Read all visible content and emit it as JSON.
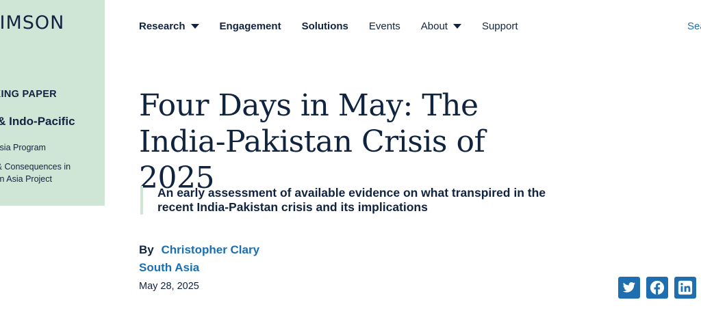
{
  "brand": {
    "logo_text": "TIMSON"
  },
  "sidebar": {
    "type_label": "RKING PAPER",
    "region_label": "a & Indo-Pacific",
    "links": [
      "th Asia Program",
      "es & Consequences in thern Asia Project"
    ]
  },
  "nav": {
    "items": [
      {
        "label": "Research",
        "has_dropdown": true
      },
      {
        "label": "Engagement",
        "has_dropdown": false
      },
      {
        "label": "Solutions",
        "has_dropdown": false
      },
      {
        "label": "Events",
        "has_dropdown": false
      },
      {
        "label": "About",
        "has_dropdown": true
      },
      {
        "label": "Support",
        "has_dropdown": false
      }
    ],
    "search_label": "Sea"
  },
  "article": {
    "title": "Four Days in May: The India-Pakistan Crisis of 2025",
    "subtitle": "An early assessment of available evidence on what transpired in the recent India-Pakistan crisis and its implications",
    "by_label": "By",
    "author": "Christopher Clary",
    "topic": "South Asia",
    "date": "May 28, 2025"
  },
  "share": {
    "icons": [
      "twitter-icon",
      "facebook-icon",
      "linkedin-icon"
    ]
  },
  "colors": {
    "navy": "#10233f",
    "link_blue": "#1a6fb3",
    "sidebar_green": "#cfe6d7",
    "share_blue": "#1f6fb0"
  }
}
